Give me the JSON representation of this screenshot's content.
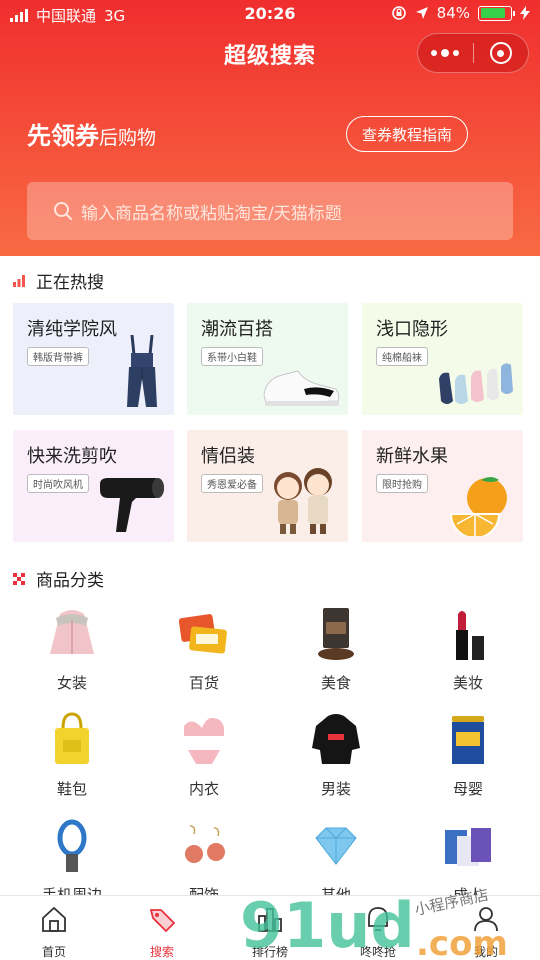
{
  "statusbar": {
    "carrier": "中国联通",
    "network": "3G",
    "time": "20:26",
    "battery_text": "84%",
    "battery_level": 0.84
  },
  "header": {
    "title": "超级搜索"
  },
  "banner": {
    "slogan_main": "先领券",
    "slogan_sub": "后购物",
    "guide_button": "查券教程指南"
  },
  "search": {
    "placeholder": "输入商品名称或粘贴淘宝/天猫标题"
  },
  "hot": {
    "title": "正在热搜",
    "items": [
      {
        "name": "清纯学院风",
        "tag": "韩版背带裤",
        "icon": "overalls-icon"
      },
      {
        "name": "潮流百搭",
        "tag": "系带小白鞋",
        "icon": "sneaker-icon"
      },
      {
        "name": "浅口隐形",
        "tag": "纯棉船袜",
        "icon": "socks-icon"
      },
      {
        "name": "快来洗剪吹",
        "tag": "时尚吹风机",
        "icon": "hair-dryer-icon"
      },
      {
        "name": "情侣装",
        "tag": "秀恩爱必备",
        "icon": "couple-icon"
      },
      {
        "name": "新鲜水果",
        "tag": "限时抢购",
        "icon": "orange-icon"
      }
    ]
  },
  "categories": {
    "title": "商品分类",
    "items": [
      {
        "label": "女装",
        "icon": "coat-icon"
      },
      {
        "label": "百货",
        "icon": "pad-icon"
      },
      {
        "label": "美食",
        "icon": "coffee-icon"
      },
      {
        "label": "美妆",
        "icon": "lipstick-icon"
      },
      {
        "label": "鞋包",
        "icon": "bag-icon"
      },
      {
        "label": "内衣",
        "icon": "lingerie-icon"
      },
      {
        "label": "男装",
        "icon": "hoodie-icon"
      },
      {
        "label": "母婴",
        "icon": "milk-powder-icon"
      },
      {
        "label": "手机周边",
        "icon": "fan-icon"
      },
      {
        "label": "配饰",
        "icon": "earring-icon"
      },
      {
        "label": "其他",
        "icon": "diamond-icon"
      },
      {
        "label": "成人",
        "icon": "box-icon"
      }
    ]
  },
  "tabbar": {
    "items": [
      {
        "label": "首页",
        "icon": "home-icon",
        "active": false
      },
      {
        "label": "搜索",
        "icon": "tag-icon",
        "active": true
      },
      {
        "label": "排行榜",
        "icon": "chart-icon",
        "active": false
      },
      {
        "label": "咚咚抢",
        "icon": "bell-icon",
        "active": false
      },
      {
        "label": "我的",
        "icon": "user-icon",
        "active": false
      }
    ]
  },
  "watermark": {
    "text_main": "91ud.com",
    "text_sub": "小程序商店"
  },
  "colors": {
    "brand_red": "#f02e2e",
    "active_tab": "#e8323c"
  }
}
